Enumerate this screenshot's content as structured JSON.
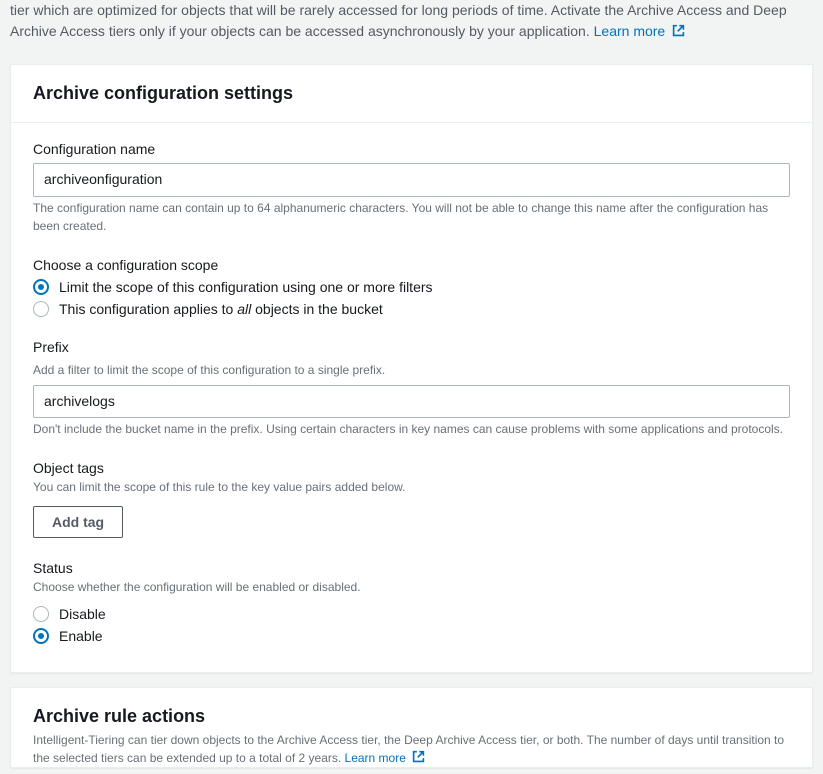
{
  "intro": {
    "text": "tier which are optimized for objects that will be rarely accessed for long periods of time. Activate the Archive Access and Deep Archive Access tiers only if your objects can be accessed asynchronously by your application. ",
    "learn_more": "Learn more"
  },
  "settings": {
    "title": "Archive configuration settings",
    "config_name": {
      "label": "Configuration name",
      "value": "archiveonfiguration",
      "hint": "The configuration name can contain up to 64 alphanumeric characters. You will not be able to change this name after the configuration has been created."
    },
    "scope": {
      "label": "Choose a configuration scope",
      "options": {
        "limit": "Limit the scope of this configuration using one or more filters",
        "all_pre": "This configuration applies to ",
        "all_em": "all",
        "all_post": " objects in the bucket"
      },
      "selected": "limit"
    },
    "prefix": {
      "label": "Prefix",
      "desc": "Add a filter to limit the scope of this configuration to a single prefix.",
      "value": "archivelogs",
      "hint": "Don't include the bucket name in the prefix. Using certain characters in key names can cause problems with some applications and protocols."
    },
    "tags": {
      "label": "Object tags",
      "desc": "You can limit the scope of this rule to the key value pairs added below.",
      "add_button": "Add tag"
    },
    "status": {
      "label": "Status",
      "desc": "Choose whether the configuration will be enabled or disabled.",
      "options": {
        "disable": "Disable",
        "enable": "Enable"
      },
      "selected": "enable"
    }
  },
  "rule_actions": {
    "title": "Archive rule actions",
    "desc_pre": "Intelligent-Tiering can tier down objects to the Archive Access tier, the Deep Archive Access tier, or both. The number of days until transition to the selected tiers can be extended up to a total of 2 years. ",
    "learn_more": "Learn more"
  }
}
